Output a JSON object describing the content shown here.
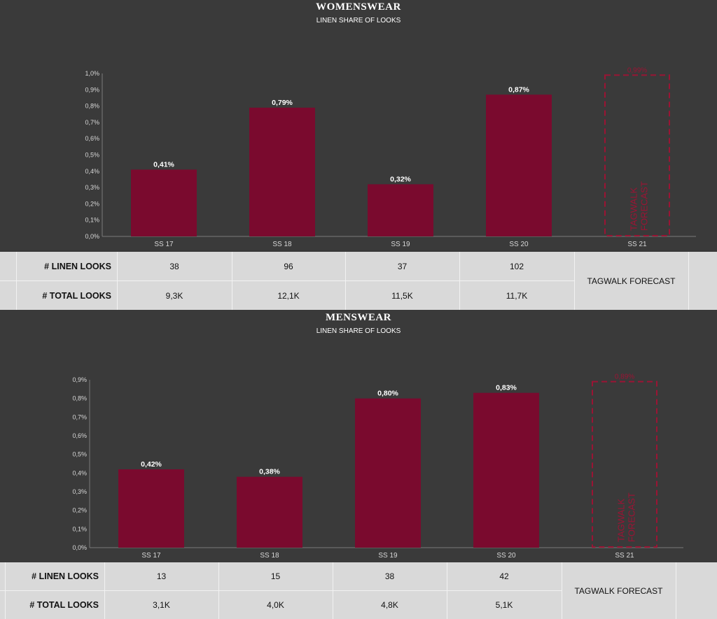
{
  "colors": {
    "background": "#3a3a3a",
    "bar": "#7a0a2e",
    "forecast": "#9b1434",
    "table_bg": "#d9d9d9",
    "axis": "#7a7a7a"
  },
  "women": {
    "title": "WOMENSWEAR",
    "subtitle": "LINEN SHARE OF LOOKS",
    "table": {
      "row1_label": "# LINEN LOOKS",
      "row2_label": "# TOTAL LOOKS",
      "linen": [
        "38",
        "96",
        "37",
        "102"
      ],
      "total": [
        "9,3K",
        "12,1K",
        "11,5K",
        "11,7K"
      ],
      "forecast_label": "TAGWALK FORECAST"
    }
  },
  "men": {
    "title": "MENSWEAR",
    "subtitle": "LINEN SHARE OF LOOKS",
    "table": {
      "row1_label": "# LINEN LOOKS",
      "row2_label": "# TOTAL LOOKS",
      "linen": [
        "13",
        "15",
        "38",
        "42"
      ],
      "total": [
        "3,1K",
        "4,0K",
        "4,8K",
        "5,1K"
      ],
      "forecast_label": "TAGWALK FORECAST"
    }
  },
  "chart_data": [
    {
      "type": "bar",
      "title": "WOMENSWEAR",
      "subtitle": "LINEN SHARE OF LOOKS",
      "categories": [
        "SS 17",
        "SS 18",
        "SS 19",
        "SS 20",
        "SS 21"
      ],
      "values": [
        0.41,
        0.79,
        0.32,
        0.87,
        0.99
      ],
      "labels": [
        "0,41%",
        "0,79%",
        "0,32%",
        "0,87%",
        "0,99%"
      ],
      "forecast_index": 4,
      "forecast_text": "TAGWALK FORECAST",
      "ylim": [
        0,
        1.0
      ],
      "yticks": [
        "0,0%",
        "0,1%",
        "0,2%",
        "0,3%",
        "0,4%",
        "0,5%",
        "0,6%",
        "0,7%",
        "0,8%",
        "0,9%",
        "1,0%"
      ],
      "grid": false,
      "legend": "none"
    },
    {
      "type": "bar",
      "title": "MENSWEAR",
      "subtitle": "LINEN SHARE OF LOOKS",
      "categories": [
        "SS 17",
        "SS 18",
        "SS 19",
        "SS 20",
        "SS 21"
      ],
      "values": [
        0.42,
        0.38,
        0.8,
        0.83,
        0.89
      ],
      "labels": [
        "0,42%",
        "0,38%",
        "0,80%",
        "0,83%",
        "0,89%"
      ],
      "forecast_index": 4,
      "forecast_text": "TAGWALK FORECAST",
      "ylim": [
        0,
        0.9
      ],
      "yticks": [
        "0,0%",
        "0,1%",
        "0,2%",
        "0,3%",
        "0,4%",
        "0,5%",
        "0,6%",
        "0,7%",
        "0,8%",
        "0,9%"
      ],
      "grid": false,
      "legend": "none"
    }
  ]
}
